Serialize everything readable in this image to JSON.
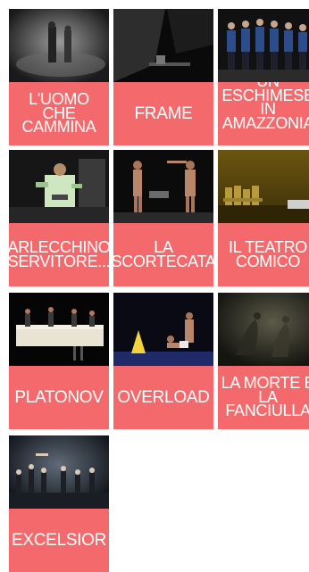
{
  "shows": [
    {
      "title": "L'UOMO CHE CAMMINA"
    },
    {
      "title": "FRAME"
    },
    {
      "title": "UN ESCHIMESE IN AMAZZONIA"
    },
    {
      "title": "ARLECCHINO SERVITORE..."
    },
    {
      "title": "LA SCORTECATA"
    },
    {
      "title": "IL TEATRO COMICO"
    },
    {
      "title": "PLATONOV"
    },
    {
      "title": "OVERLOAD"
    },
    {
      "title": "LA MORTE E LA FANCIULLA"
    },
    {
      "title": "EXCELSIOR"
    }
  ]
}
